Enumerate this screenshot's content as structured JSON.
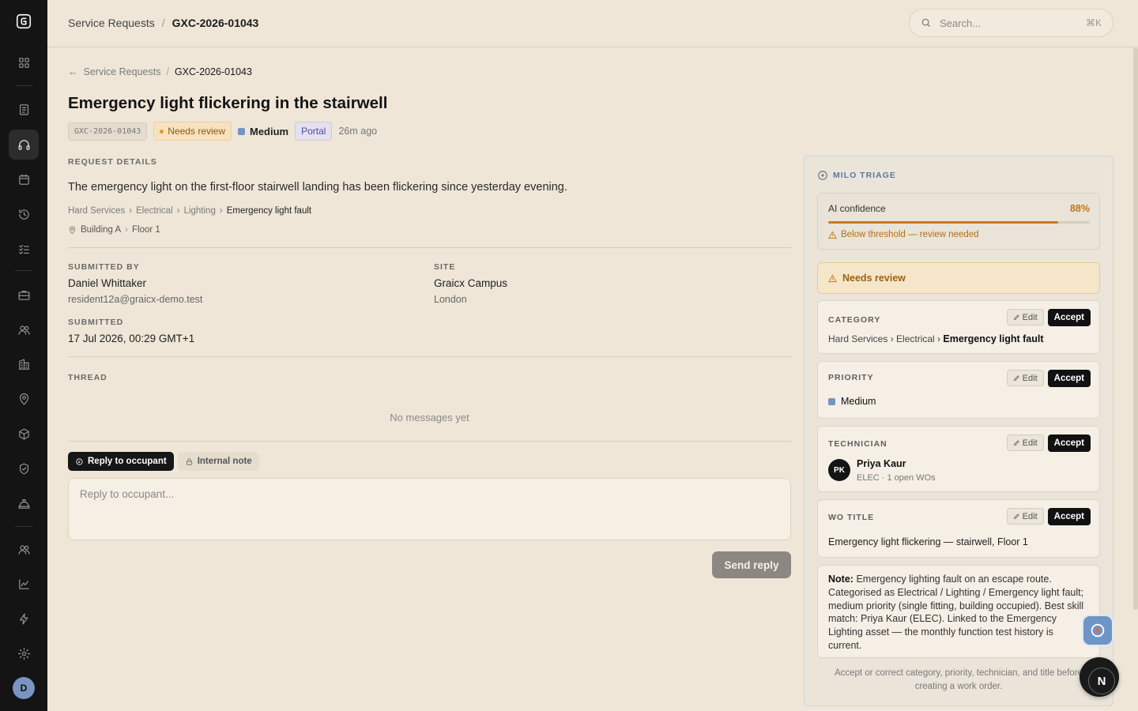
{
  "topbar": {
    "crumbs": [
      "Service Requests",
      "/",
      "GXC-2026-01043"
    ],
    "search_placeholder": "Search...",
    "search_shortcut": "⌘K"
  },
  "sidebar": {
    "items": [
      "logo-icon",
      "dashboard-icon",
      "clipboard-icon",
      "headset-icon",
      "calendar-icon",
      "history-icon",
      "checklist-icon",
      "briefcase-icon",
      "users-icon",
      "building-icon",
      "map-pin-icon",
      "box-icon",
      "shield-icon",
      "safety-helmet-icon",
      "team-icon",
      "chart-icon",
      "lightning-icon",
      "gear-icon"
    ],
    "active": "headset-icon",
    "avatar_initial": "D"
  },
  "page": {
    "back_crumb": "Service Requests",
    "crumb_sep": "/",
    "crumb_current": "GXC-2026-01043",
    "title": "Emergency light flickering in the stairwell",
    "request_id": "GXC-2026-01043",
    "status": "Needs review",
    "priority": "Medium",
    "channel": "Portal",
    "age": "26m ago"
  },
  "details": {
    "heading": "REQUEST DETAILS",
    "description": "The emergency light on the first-floor stairwell landing has been flickering since yesterday evening.",
    "category_path": [
      "Hard Services",
      "Electrical",
      "Lighting",
      "Emergency light fault"
    ],
    "location": [
      "Building A",
      "Floor 1"
    ],
    "submitted_by_label": "SUBMITTED BY",
    "submitted_by_name": "Daniel Whittaker",
    "submitted_by_email": "resident12a@graicx-demo.test",
    "site_label": "SITE",
    "site_name": "Graicx Campus",
    "site_city": "London",
    "submitted_label": "SUBMITTED",
    "submitted_at": "17 Jul 2026, 00:29 GMT+1"
  },
  "thread": {
    "heading": "THREAD",
    "empty": "No messages yet",
    "tab_reply": "Reply to occupant",
    "tab_note": "Internal note",
    "reply_placeholder": "Reply to occupant...",
    "send_label": "Send reply"
  },
  "triage": {
    "heading": "MILO TRIAGE",
    "confidence_label": "AI confidence",
    "confidence_value": "88%",
    "confidence_fraction": 0.88,
    "threshold_warning": "Below threshold — review needed",
    "needs_review": "Needs review",
    "edit_label": "Edit",
    "accept_label": "Accept",
    "category_label": "CATEGORY",
    "category_prefix": "Hard Services › Electrical ›",
    "category_leaf": "Emergency light fault",
    "priority_label": "PRIORITY",
    "priority_value": "Medium",
    "technician_label": "TECHNICIAN",
    "technician_initials": "PK",
    "technician_name": "Priya Kaur",
    "technician_meta": "ELEC · 1 open WOs",
    "wo_title_label": "WO TITLE",
    "wo_title_value": "Emergency light flickering — stairwell, Floor 1",
    "note_label": "Note:",
    "note_text": "Emergency lighting fault on an escape route. Categorised as Electrical / Lighting / Emergency light fault; medium priority (single fitting, building occupied). Best skill match: Priya Kaur (ELEC). Linked to the Emergency Lighting asset — the monthly function test history is current.",
    "footer_hint": "Accept or correct category, priority, technician, and title before creating a work order."
  },
  "fab": {
    "n_label": "N"
  },
  "colors": {
    "accent": "#5a77a8",
    "warning": "#c97a1e",
    "priority_medium": "#7295c2"
  }
}
